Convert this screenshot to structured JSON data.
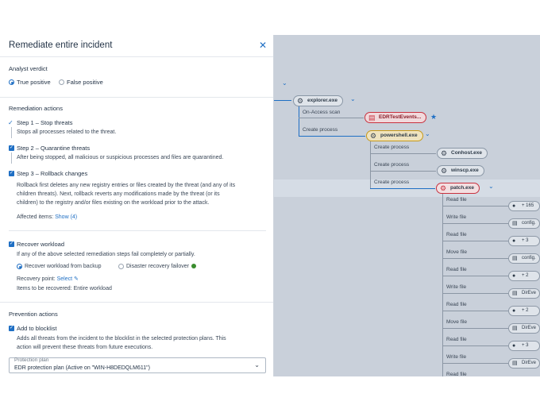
{
  "dialog": {
    "title": "Remediate entire incident",
    "close_icon": "close-icon"
  },
  "verdict": {
    "heading": "Analyst verdict",
    "true_positive": "True positive",
    "false_positive": "False positive",
    "selected": "True positive"
  },
  "remediation": {
    "heading": "Remediation actions",
    "step1_title": "Step 1 – Stop threats",
    "step1_desc": "Stops all processes related to the threat.",
    "step2_title": "Step 2 – Quarantine threats",
    "step2_desc": "After being stopped, all malicious or suspicious processes and files are quarantined.",
    "step3_title": "Step 3 – Rollback changes",
    "step3_desc_1": "Rollback first deletes any new registry entries or files created by the threat (and any of its",
    "step3_desc_2": "children threats). Next, rollback reverts any modifications made by the threat (or its",
    "step3_desc_3": "children) to the registry and/or files existing on the workload prior to the attack.",
    "affected_label": "Affected items:",
    "affected_link": "Show (4)",
    "recover_title": "Recover workload",
    "recover_desc": "If any of the above selected remediation steps fail completely or partially.",
    "recover_backup": "Recover workload from backup",
    "recover_failover": "Disaster recovery failover",
    "recovery_point_label": "Recovery point:",
    "recovery_point_link": "Select",
    "items_label": "Items to be recovered:",
    "items_value": "Entire workload"
  },
  "prevention": {
    "heading": "Prevention actions",
    "blocklist_title": "Add to blocklist",
    "blocklist_desc_1": "Adds all threats from the incident to the blocklist in the selected protection plans. This",
    "blocklist_desc_2": "action will prevent these threats from future executions.",
    "plan_label": "Protection plan",
    "plan_value": "EDR protection plan (Active on \"WIN-H8DEDQLM611\")"
  },
  "graph": {
    "explorer": "explorer.exe",
    "edge_onaccess": "On-Access scan",
    "edr_test": "EDRTestEvents...",
    "edge_create1": "Create process",
    "powershell": "powershell.exe",
    "edge_create2": "Create process",
    "conhost": "Conhost.exe",
    "edge_create3": "Create process",
    "winscp": "winscp.exe",
    "edge_create4": "Create process",
    "patch": "patch.exe",
    "file_events": [
      "Read file",
      "Write file",
      "Read file",
      "Move file",
      "Read file",
      "Write file",
      "Read file",
      "Move file",
      "Read file",
      "Write file",
      "Read file"
    ],
    "pills": [
      "+ 165",
      "config.",
      "+ 3",
      "config.",
      "+ 2",
      "DirEve",
      "+ 2",
      "DirEve",
      "+ 3",
      "DirEve"
    ]
  },
  "colors": {
    "accent": "#1f6fc4",
    "danger": "#c8313f",
    "warning": "#c89a1a",
    "success": "#3a8d2e"
  }
}
